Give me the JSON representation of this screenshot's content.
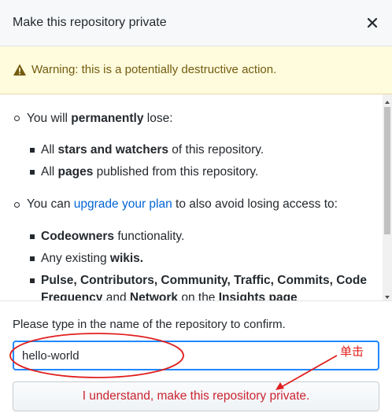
{
  "dialog": {
    "title": "Make this repository private",
    "close_icon": "close-icon"
  },
  "warning": {
    "icon": "alert-triangle-icon",
    "text": "Warning: this is a potentially destructive action."
  },
  "content": {
    "lose_intro": {
      "prefix": "You will ",
      "bold": "permanently",
      "suffix": " lose:"
    },
    "lose_items": [
      {
        "prefix": "All ",
        "bold": "stars and watchers",
        "suffix": " of this repository."
      },
      {
        "prefix": "All ",
        "bold": "pages",
        "suffix": " published from this repository."
      }
    ],
    "upgrade_intro": {
      "prefix": "You can ",
      "link": "upgrade your plan",
      "suffix": " to also avoid losing access to:"
    },
    "access_items": [
      {
        "prefix": "",
        "bold": "Codeowners",
        "suffix": " functionality."
      },
      {
        "prefix": "Any existing ",
        "bold": "wikis.",
        "suffix": ""
      }
    ],
    "last_item": {
      "line1": "Pulse, Contributors, Community, Traffic, Commits, Code",
      "line2_bold1": "Frequency",
      "line2_mid1": " and ",
      "line2_bold2": "Network",
      "line2_mid2": " on the ",
      "line2_bold3": "Insights page"
    }
  },
  "footer": {
    "confirm_label": "Please type in the name of the repository to confirm.",
    "input_value": "hello-world",
    "button_label": "I understand, make this repository private."
  },
  "annotation": {
    "label": "单击",
    "color": "#e02020"
  }
}
